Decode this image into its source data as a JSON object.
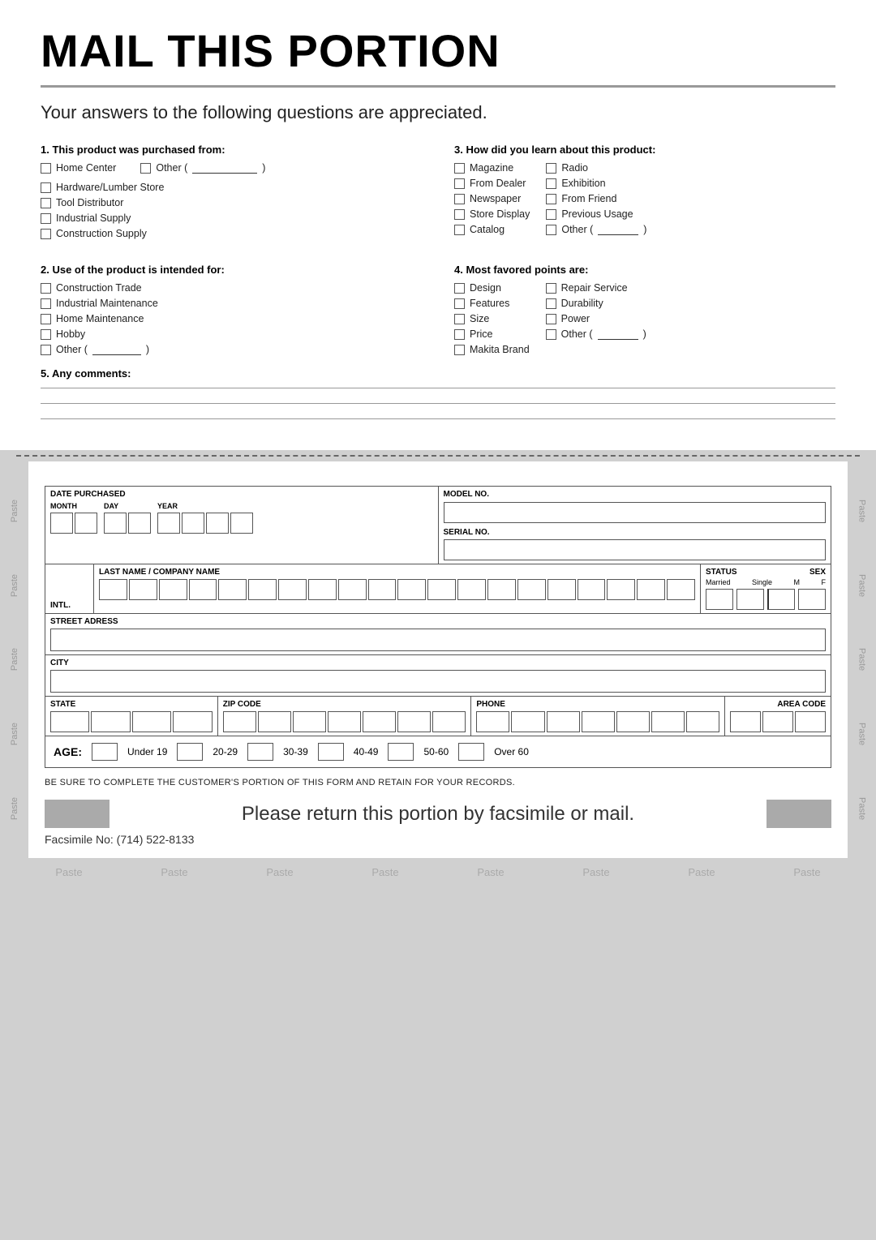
{
  "page": {
    "title": "MAIL THIS PORTION",
    "subtitle": "Your answers to the following questions are appreciated.",
    "cut_line": "- . - . - . - . - . - . - . - . - . - . - . -"
  },
  "questions": {
    "q1": {
      "title": "1. This product was purchased from:",
      "items": [
        "Home Center",
        "Hardware/Lumber Store",
        "Tool Distributor",
        "Industrial Supply",
        "Construction Supply"
      ],
      "other_label": "Other ("
    },
    "q2": {
      "title": "2. Use of the product is intended for:",
      "items": [
        "Construction Trade",
        "Industrial Maintenance",
        "Home Maintenance",
        "Hobby"
      ],
      "other_label": "Other ("
    },
    "q3": {
      "title": "3. How did you learn about this product:",
      "col1": [
        "Magazine",
        "From Dealer",
        "Newspaper",
        "Store Display",
        "Catalog"
      ],
      "col2": [
        "Radio",
        "Exhibition",
        "From Friend",
        "Previous Usage"
      ],
      "other_label": "Other ("
    },
    "q4": {
      "title": "4. Most favored points are:",
      "col1": [
        "Design",
        "Features",
        "Size",
        "Price",
        "Makita Brand"
      ],
      "col2": [
        "Repair Service",
        "Durability",
        "Power"
      ],
      "other_label": "Other ("
    },
    "q5": {
      "title": "5. Any comments:"
    }
  },
  "form": {
    "date_label": "DATE PURCHASED",
    "month_label": "MONTH",
    "day_label": "DAY",
    "year_label": "YEAR",
    "model_label": "MODEL NO.",
    "serial_label": "SERIAL NO.",
    "intl_label": "INTL.",
    "name_label": "LAST NAME / COMPANY NAME",
    "status_label": "STATUS",
    "sex_label": "SEX",
    "married_label": "Married",
    "single_label": "Single",
    "m_label": "M",
    "f_label": "F",
    "street_label": "STREET ADRESS",
    "city_label": "CITY",
    "state_label": "STATE",
    "zip_label": "ZIP CODE",
    "phone_label": "PHONE",
    "area_label": "AREA CODE",
    "age_label": "AGE:",
    "age_ranges": [
      "Under 19",
      "20-29",
      "30-39",
      "40-49",
      "50-60",
      "Over 60"
    ]
  },
  "footer": {
    "note": "BE SURE TO COMPLETE THE CUSTOMER'S PORTION OF THIS FORM AND RETAIN FOR YOUR RECORDS.",
    "return_text": "Please return this portion by facsimile or mail.",
    "fax_label": "Facsimile No: (714) 522-8133"
  },
  "paste_labels": {
    "left": [
      "Paste",
      "Paste",
      "Paste",
      "Paste",
      "Paste"
    ],
    "right": [
      "Paste",
      "Paste",
      "Paste",
      "Paste",
      "Paste"
    ],
    "bottom": [
      "Paste",
      "Paste",
      "Paste",
      "Paste",
      "Paste",
      "Paste",
      "Paste",
      "Paste"
    ]
  }
}
